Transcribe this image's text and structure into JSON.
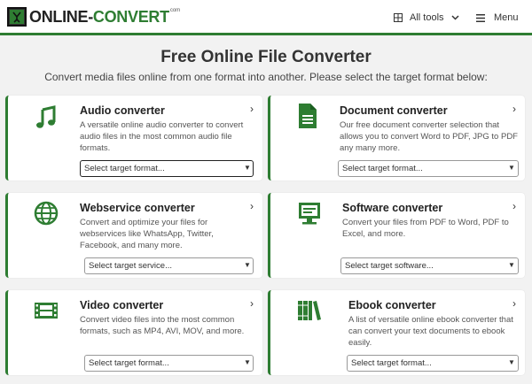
{
  "header": {
    "logo_text_a": "ONLINE-",
    "logo_text_b": "CONVERT",
    "logo_com": "com",
    "all_tools_label": "All tools",
    "menu_label": "Menu"
  },
  "main": {
    "title": "Free Online File Converter",
    "subtitle": "Convert media files online from one format into another. Please select the target format below:"
  },
  "cards": [
    {
      "title": "Audio converter",
      "desc_lines": [
        "A versatile online audio converter to convert",
        "audio files in the most common audio file",
        "formats."
      ],
      "select": "Select target format...",
      "icon": "music-note-icon"
    },
    {
      "title": "Document converter",
      "desc_lines": [
        "Our free document converter selection that",
        "allows you to convert Word to PDF, JPG to PDF",
        "any many more."
      ],
      "select": "Select target format...",
      "icon": "document-icon"
    },
    {
      "title": "Webservice converter",
      "desc_lines": [
        "Convert and optimize your files for",
        "webservices like WhatsApp, Twitter,",
        "Facebook, and many more."
      ],
      "select": "Select target service...",
      "icon": "globe-icon"
    },
    {
      "title": "Software converter",
      "desc_lines": [
        "Convert your files from PDF to Word, PDF to",
        "Excel, and more."
      ],
      "select": "Select target software...",
      "icon": "monitor-icon"
    },
    {
      "title": "Video converter",
      "desc_lines": [
        "Convert video files into the most common",
        "formats, such as MP4, AVI, MOV, and more."
      ],
      "select": "Select target format...",
      "icon": "film-icon"
    },
    {
      "title": "Ebook converter",
      "desc_lines": [
        "A list of versatile online ebook converter that",
        "can convert your text documents to ebook",
        "easily."
      ],
      "select": "Select target format...",
      "icon": "books-icon"
    }
  ],
  "colors": {
    "accent": "#2e7d32",
    "background": "#f2f2f2",
    "card": "#ffffff"
  }
}
